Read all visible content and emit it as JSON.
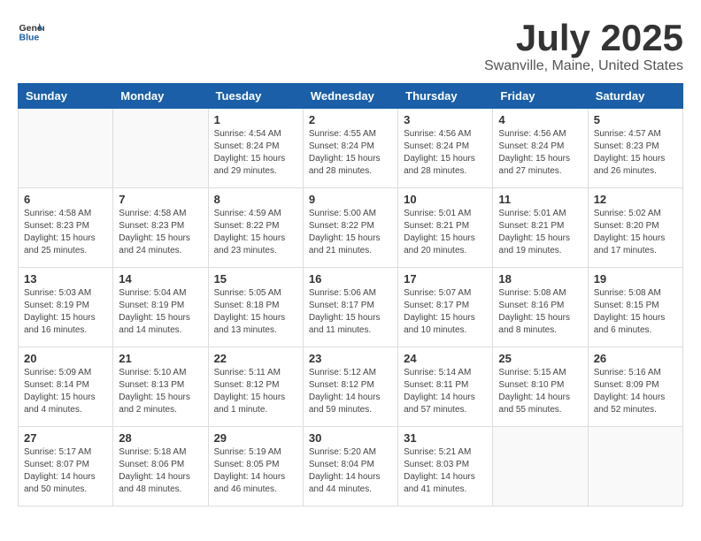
{
  "header": {
    "logo_general": "General",
    "logo_blue": "Blue",
    "title": "July 2025",
    "subtitle": "Swanville, Maine, United States"
  },
  "weekdays": [
    "Sunday",
    "Monday",
    "Tuesday",
    "Wednesday",
    "Thursday",
    "Friday",
    "Saturday"
  ],
  "weeks": [
    [
      {
        "day": "",
        "info": ""
      },
      {
        "day": "",
        "info": ""
      },
      {
        "day": "1",
        "info": "Sunrise: 4:54 AM\nSunset: 8:24 PM\nDaylight: 15 hours\nand 29 minutes."
      },
      {
        "day": "2",
        "info": "Sunrise: 4:55 AM\nSunset: 8:24 PM\nDaylight: 15 hours\nand 28 minutes."
      },
      {
        "day": "3",
        "info": "Sunrise: 4:56 AM\nSunset: 8:24 PM\nDaylight: 15 hours\nand 28 minutes."
      },
      {
        "day": "4",
        "info": "Sunrise: 4:56 AM\nSunset: 8:24 PM\nDaylight: 15 hours\nand 27 minutes."
      },
      {
        "day": "5",
        "info": "Sunrise: 4:57 AM\nSunset: 8:23 PM\nDaylight: 15 hours\nand 26 minutes."
      }
    ],
    [
      {
        "day": "6",
        "info": "Sunrise: 4:58 AM\nSunset: 8:23 PM\nDaylight: 15 hours\nand 25 minutes."
      },
      {
        "day": "7",
        "info": "Sunrise: 4:58 AM\nSunset: 8:23 PM\nDaylight: 15 hours\nand 24 minutes."
      },
      {
        "day": "8",
        "info": "Sunrise: 4:59 AM\nSunset: 8:22 PM\nDaylight: 15 hours\nand 23 minutes."
      },
      {
        "day": "9",
        "info": "Sunrise: 5:00 AM\nSunset: 8:22 PM\nDaylight: 15 hours\nand 21 minutes."
      },
      {
        "day": "10",
        "info": "Sunrise: 5:01 AM\nSunset: 8:21 PM\nDaylight: 15 hours\nand 20 minutes."
      },
      {
        "day": "11",
        "info": "Sunrise: 5:01 AM\nSunset: 8:21 PM\nDaylight: 15 hours\nand 19 minutes."
      },
      {
        "day": "12",
        "info": "Sunrise: 5:02 AM\nSunset: 8:20 PM\nDaylight: 15 hours\nand 17 minutes."
      }
    ],
    [
      {
        "day": "13",
        "info": "Sunrise: 5:03 AM\nSunset: 8:19 PM\nDaylight: 15 hours\nand 16 minutes."
      },
      {
        "day": "14",
        "info": "Sunrise: 5:04 AM\nSunset: 8:19 PM\nDaylight: 15 hours\nand 14 minutes."
      },
      {
        "day": "15",
        "info": "Sunrise: 5:05 AM\nSunset: 8:18 PM\nDaylight: 15 hours\nand 13 minutes."
      },
      {
        "day": "16",
        "info": "Sunrise: 5:06 AM\nSunset: 8:17 PM\nDaylight: 15 hours\nand 11 minutes."
      },
      {
        "day": "17",
        "info": "Sunrise: 5:07 AM\nSunset: 8:17 PM\nDaylight: 15 hours\nand 10 minutes."
      },
      {
        "day": "18",
        "info": "Sunrise: 5:08 AM\nSunset: 8:16 PM\nDaylight: 15 hours\nand 8 minutes."
      },
      {
        "day": "19",
        "info": "Sunrise: 5:08 AM\nSunset: 8:15 PM\nDaylight: 15 hours\nand 6 minutes."
      }
    ],
    [
      {
        "day": "20",
        "info": "Sunrise: 5:09 AM\nSunset: 8:14 PM\nDaylight: 15 hours\nand 4 minutes."
      },
      {
        "day": "21",
        "info": "Sunrise: 5:10 AM\nSunset: 8:13 PM\nDaylight: 15 hours\nand 2 minutes."
      },
      {
        "day": "22",
        "info": "Sunrise: 5:11 AM\nSunset: 8:12 PM\nDaylight: 15 hours\nand 1 minute."
      },
      {
        "day": "23",
        "info": "Sunrise: 5:12 AM\nSunset: 8:12 PM\nDaylight: 14 hours\nand 59 minutes."
      },
      {
        "day": "24",
        "info": "Sunrise: 5:14 AM\nSunset: 8:11 PM\nDaylight: 14 hours\nand 57 minutes."
      },
      {
        "day": "25",
        "info": "Sunrise: 5:15 AM\nSunset: 8:10 PM\nDaylight: 14 hours\nand 55 minutes."
      },
      {
        "day": "26",
        "info": "Sunrise: 5:16 AM\nSunset: 8:09 PM\nDaylight: 14 hours\nand 52 minutes."
      }
    ],
    [
      {
        "day": "27",
        "info": "Sunrise: 5:17 AM\nSunset: 8:07 PM\nDaylight: 14 hours\nand 50 minutes."
      },
      {
        "day": "28",
        "info": "Sunrise: 5:18 AM\nSunset: 8:06 PM\nDaylight: 14 hours\nand 48 minutes."
      },
      {
        "day": "29",
        "info": "Sunrise: 5:19 AM\nSunset: 8:05 PM\nDaylight: 14 hours\nand 46 minutes."
      },
      {
        "day": "30",
        "info": "Sunrise: 5:20 AM\nSunset: 8:04 PM\nDaylight: 14 hours\nand 44 minutes."
      },
      {
        "day": "31",
        "info": "Sunrise: 5:21 AM\nSunset: 8:03 PM\nDaylight: 14 hours\nand 41 minutes."
      },
      {
        "day": "",
        "info": ""
      },
      {
        "day": "",
        "info": ""
      }
    ]
  ]
}
